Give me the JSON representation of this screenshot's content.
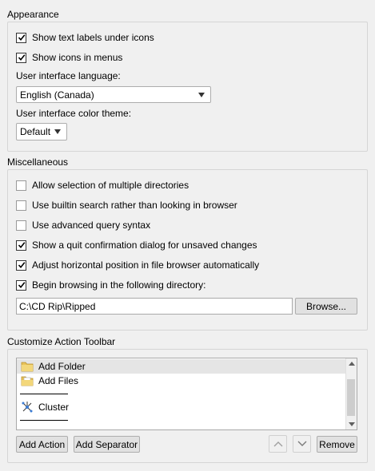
{
  "appearance": {
    "title": "Appearance",
    "show_text_labels": {
      "label": "Show text labels under icons",
      "checked": true
    },
    "show_icons_menus": {
      "label": "Show icons in menus",
      "checked": true
    },
    "language_label": "User interface language:",
    "language_value": "English (Canada)",
    "theme_label": "User interface color theme:",
    "theme_value": "Default"
  },
  "misc": {
    "title": "Miscellaneous",
    "options": [
      {
        "label": "Allow selection of multiple directories",
        "checked": false
      },
      {
        "label": "Use builtin search rather than looking in browser",
        "checked": false
      },
      {
        "label": "Use advanced query syntax",
        "checked": false
      },
      {
        "label": "Show a quit confirmation dialog for unsaved changes",
        "checked": true
      },
      {
        "label": "Adjust horizontal position in file browser automatically",
        "checked": true
      },
      {
        "label": "Begin browsing in the following directory:",
        "checked": true
      }
    ],
    "directory_value": "C:\\CD Rip\\Ripped",
    "browse_label": "Browse..."
  },
  "toolbar": {
    "title": "Customize Action Toolbar",
    "items": [
      {
        "label": "Add Folder",
        "icon": "folder-icon",
        "selected": true
      },
      {
        "label": "Add Files",
        "icon": "files-icon",
        "selected": false
      },
      {
        "label": "Cluster",
        "icon": "cluster-icon",
        "selected": false
      }
    ],
    "add_action_label": "Add Action",
    "add_separator_label": "Add Separator",
    "remove_label": "Remove"
  }
}
